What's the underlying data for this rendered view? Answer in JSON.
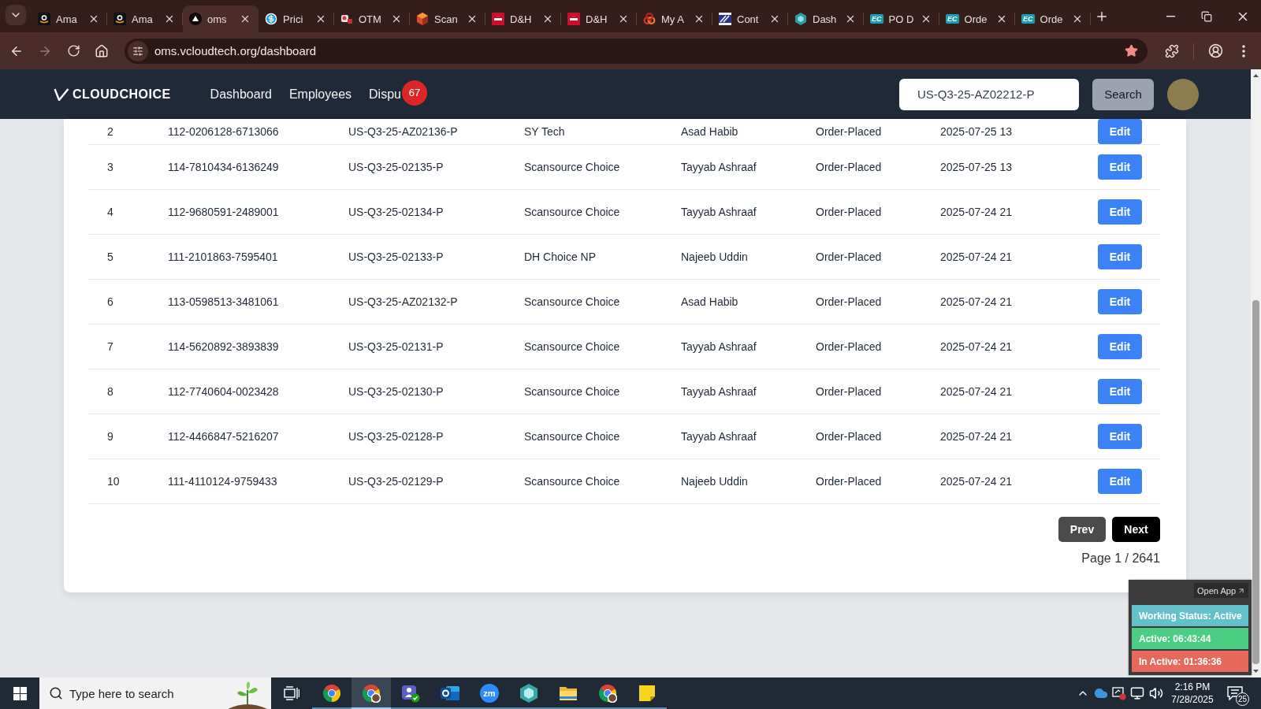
{
  "browser": {
    "tabs": [
      {
        "title": "Ama",
        "kind": "amazon",
        "selected": false
      },
      {
        "title": "Ama",
        "kind": "amazon",
        "selected": false
      },
      {
        "title": "oms",
        "kind": "triangle",
        "selected": true
      },
      {
        "title": "Prici",
        "kind": "dollar",
        "selected": false
      },
      {
        "title": "OTM",
        "kind": "tag",
        "selected": false
      },
      {
        "title": "Scan",
        "kind": "cube",
        "selected": false
      },
      {
        "title": "D&H",
        "kind": "dh",
        "selected": false
      },
      {
        "title": "D&H",
        "kind": "dh",
        "selected": false
      },
      {
        "title": "My A",
        "kind": "rings",
        "selected": false
      },
      {
        "title": "Cont",
        "kind": "stripes",
        "selected": false
      },
      {
        "title": "Dash",
        "kind": "hexagon",
        "selected": false
      },
      {
        "title": "PO D",
        "kind": "text",
        "icon_text": "EC",
        "selected": false
      },
      {
        "title": "Orde",
        "kind": "text",
        "icon_text": "EC",
        "selected": false
      },
      {
        "title": "Orde",
        "kind": "text",
        "icon_text": "EC",
        "selected": false
      }
    ],
    "address": "oms.vcloudtech.org/dashboard",
    "bookmarked": true
  },
  "header": {
    "logo": "CLOUDCHOICE",
    "nav": [
      {
        "label": "Dashboard"
      },
      {
        "label": "Employees"
      },
      {
        "label": "Dispu",
        "badge": "67"
      }
    ],
    "search": {
      "value": "US-Q3-25-AZ02212-P"
    },
    "search_button": "Search"
  },
  "table": {
    "rows": [
      {
        "cells": [
          "2",
          "112-0206128-6713066",
          "US-Q3-25-AZ02136-P",
          "SY Tech",
          "Asad Habib",
          "Order-Placed",
          "2025-07-25 13"
        ],
        "action": "Edit"
      },
      {
        "cells": [
          "3",
          "114-7810434-6136249",
          "US-Q3-25-02135-P",
          "Scansource Choice",
          "Tayyab Ashraaf",
          "Order-Placed",
          "2025-07-25 13"
        ],
        "action": "Edit"
      },
      {
        "cells": [
          "4",
          "112-9680591-2489001",
          "US-Q3-25-02134-P",
          "Scansource Choice",
          "Tayyab Ashraaf",
          "Order-Placed",
          "2025-07-24 21"
        ],
        "action": "Edit"
      },
      {
        "cells": [
          "5",
          "111-2101863-7595401",
          "US-Q3-25-02133-P",
          "DH Choice NP",
          "Najeeb Uddin",
          "Order-Placed",
          "2025-07-24 21"
        ],
        "action": "Edit"
      },
      {
        "cells": [
          "6",
          "113-0598513-3481061",
          "US-Q3-25-AZ02132-P",
          "Scansource Choice",
          "Asad Habib",
          "Order-Placed",
          "2025-07-24 21"
        ],
        "action": "Edit"
      },
      {
        "cells": [
          "7",
          "114-5620892-3893839",
          "US-Q3-25-02131-P",
          "Scansource Choice",
          "Tayyab Ashraaf",
          "Order-Placed",
          "2025-07-24 21"
        ],
        "action": "Edit"
      },
      {
        "cells": [
          "8",
          "112-7740604-0023428",
          "US-Q3-25-02130-P",
          "Scansource Choice",
          "Tayyab Ashraaf",
          "Order-Placed",
          "2025-07-24 21"
        ],
        "action": "Edit"
      },
      {
        "cells": [
          "9",
          "112-4466847-5216207",
          "US-Q3-25-02128-P",
          "Scansource Choice",
          "Tayyab Ashraaf",
          "Order-Placed",
          "2025-07-24 21"
        ],
        "action": "Edit"
      },
      {
        "cells": [
          "10",
          "111-4110124-9759433",
          "US-Q3-25-02129-P",
          "Scansource Choice",
          "Najeeb Uddin",
          "Order-Placed",
          "2025-07-24 21"
        ],
        "action": "Edit"
      }
    ]
  },
  "pagination": {
    "prev": "Prev",
    "next": "Next",
    "page": "Page 1 / 2641"
  },
  "widget": {
    "open_app": "Open App",
    "rows": [
      {
        "label": "Working Status: Active",
        "color": "#64c1cb"
      },
      {
        "label": "Active: 06:43:44",
        "color": "#4ccd84"
      },
      {
        "label": "In Active: 01:36:36",
        "color": "#e56a5c"
      }
    ]
  },
  "taskbar": {
    "search": {
      "placeholder": "Type here to search"
    },
    "apps": [
      {
        "kind": "browser",
        "selected": false
      },
      {
        "kind": "browser_profile",
        "selected": true
      },
      {
        "kind": "people",
        "selected": false
      },
      {
        "kind": "mail",
        "selected": false
      },
      {
        "kind": "logo",
        "text": "zm",
        "selected": false
      },
      {
        "kind": "hexagon",
        "selected": false
      },
      {
        "kind": "folder",
        "selected": false
      },
      {
        "kind": "browser_profile",
        "selected": false
      },
      {
        "kind": "note",
        "selected": false
      }
    ],
    "time": "2:16 PM",
    "date": "7/28/2025",
    "notifications": "25"
  }
}
